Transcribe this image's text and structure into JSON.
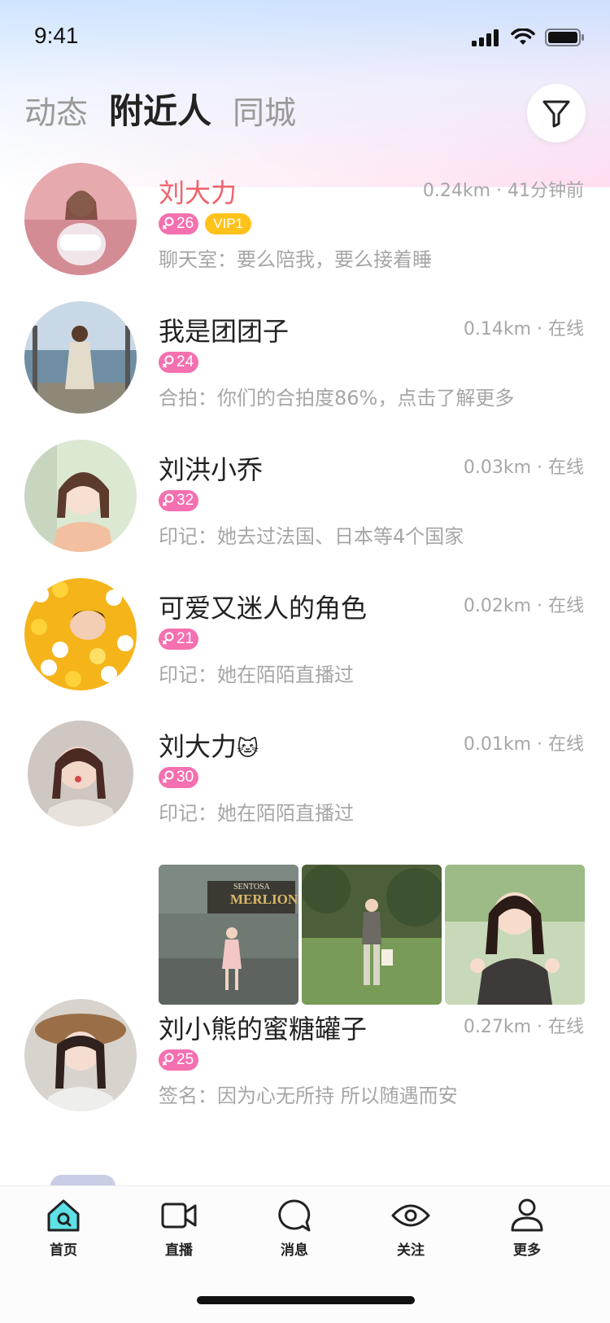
{
  "status_bar": {
    "time": "9:41"
  },
  "tabs": [
    {
      "label": "动态",
      "active": false
    },
    {
      "label": "附近人",
      "active": true
    },
    {
      "label": "同城",
      "active": false
    }
  ],
  "users": [
    {
      "name": "刘大力",
      "distance": "0.24km",
      "time": "41分钟前",
      "age": "26",
      "vip": "VIP1",
      "desc": "聊天室：要么陪我，要么接着睡"
    },
    {
      "name": "我是团团子",
      "distance": "0.14km",
      "time": "在线",
      "age": "24",
      "desc": "合拍：你们的合拍度86%，点击了解更多"
    },
    {
      "name": "刘洪小乔",
      "distance": "0.03km",
      "time": "在线",
      "age": "32",
      "desc": "印记：她去过法国、日本等4个国家"
    },
    {
      "name": "可爱又迷人的角色",
      "distance": "0.02km",
      "time": "在线",
      "age": "21",
      "desc": "印记：她在陌陌直播过"
    },
    {
      "name": "刘大力",
      "emoji": "🐱",
      "distance": "0.01km",
      "time": "在线",
      "age": "30",
      "desc": "印记：她在陌陌直播过",
      "photo_text": [
        "SENTOSA",
        "MERLION"
      ]
    },
    {
      "name": "刘小熊的蜜糖罐子",
      "distance": "0.27km",
      "time": "在线",
      "age": "25",
      "desc": "签名：因为心无所持 所以随遇而安"
    }
  ],
  "nav": [
    {
      "label": "首页",
      "icon": "home-icon",
      "active": true
    },
    {
      "label": "直播",
      "icon": "video-camera-icon"
    },
    {
      "label": "消息",
      "icon": "chat-bubble-icon"
    },
    {
      "label": "关注",
      "icon": "eye-icon"
    },
    {
      "label": "更多",
      "icon": "user-icon"
    }
  ],
  "colors": {
    "accent_red": "#f0626b",
    "gender_badge": "#f470b0",
    "vip_badge": "#ffc21a",
    "nav_active_fill": "#5de0e6"
  }
}
